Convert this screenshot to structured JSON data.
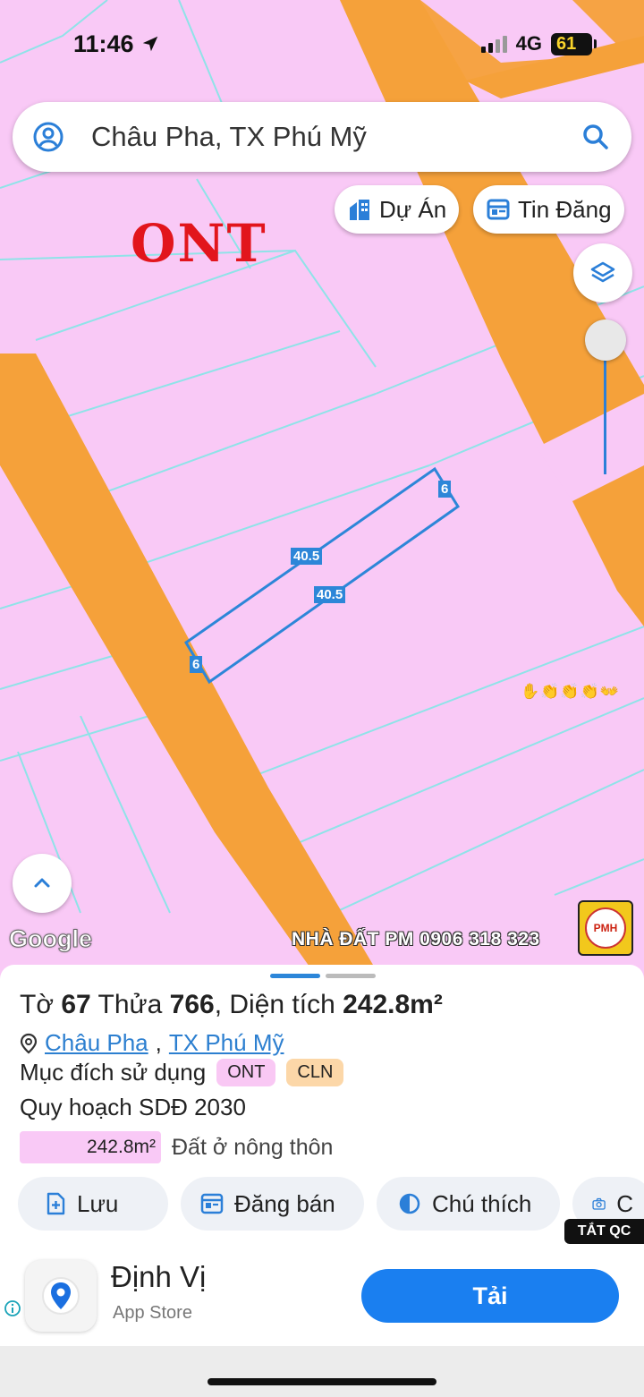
{
  "status_bar": {
    "time": "11:46",
    "network": "4G",
    "battery": "61",
    "location_icon": "location-arrow-icon",
    "signal_icon": "cellular-signal-icon"
  },
  "search": {
    "query": "Châu Pha, TX Phú Mỹ",
    "profile_icon": "user-circle-icon",
    "search_icon": "magnifier-icon"
  },
  "map_chips": {
    "projects_label": "Dự Án",
    "listings_label": "Tin Đăng"
  },
  "map": {
    "zone_label": "ONT",
    "dimensions": {
      "top_side": "40.5",
      "bottom_side": "40.5",
      "left_side": "6",
      "right_side": "6"
    },
    "provider": "Google",
    "watermark": "NHÀ ĐẤT PM 0906 318 323",
    "logo_text": "PMH",
    "colors": {
      "residential": "#f9c9f6",
      "road": "#f5a13a",
      "parcel_outline": "#2d86d8"
    }
  },
  "parcel": {
    "sheet_label": "Tờ",
    "sheet_no": "67",
    "lot_label": "Thửa",
    "lot_no": "766",
    "area_label": "Diện tích",
    "area": "242.8m²",
    "commune": "Châu Pha",
    "district": "TX Phú Mỹ",
    "purpose_label": "Mục đích sử dụng",
    "purpose_codes": [
      "ONT",
      "CLN"
    ],
    "plan_label": "Quy hoạch SDĐ 2030",
    "plan_area": "242.8m²",
    "plan_type": "Đất ở nông thôn"
  },
  "actions": {
    "save": "Lưu",
    "post_sale": "Đăng bán",
    "legend": "Chú thích",
    "more": "C"
  },
  "ad": {
    "close_ads": "TẮT QC",
    "app_name": "Định Vị",
    "store": "App Store",
    "install": "Tải"
  }
}
